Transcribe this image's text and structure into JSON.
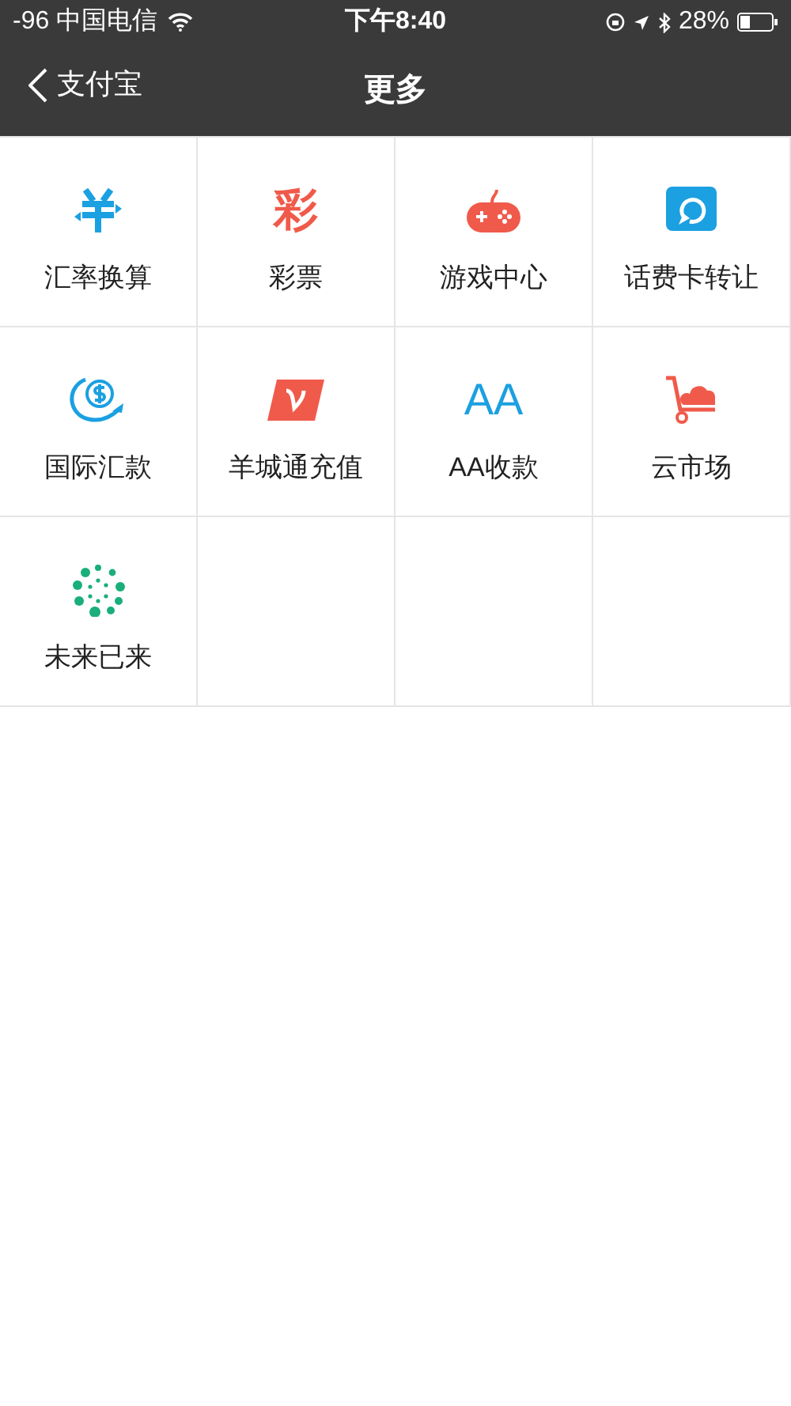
{
  "status_bar": {
    "carrier": "-96 中国电信",
    "time": "下午8:40",
    "battery": "28%"
  },
  "nav": {
    "back": "支付宝",
    "title": "更多"
  },
  "grid": [
    {
      "kind": "exchange",
      "label": "汇率换算"
    },
    {
      "kind": "glyph",
      "glyph": "彩",
      "label": "彩票"
    },
    {
      "kind": "gamepad",
      "label": "游戏中心"
    },
    {
      "kind": "refresh-card",
      "label": "话费卡转让"
    },
    {
      "kind": "dollar-arrow",
      "label": "国际汇款"
    },
    {
      "kind": "v-card",
      "label": "羊城通充值"
    },
    {
      "kind": "glyph-blue",
      "glyph": "AA",
      "label": "AA收款"
    },
    {
      "kind": "cart-cloud",
      "label": "云市场"
    },
    {
      "kind": "burst",
      "label": "未来已来"
    }
  ]
}
